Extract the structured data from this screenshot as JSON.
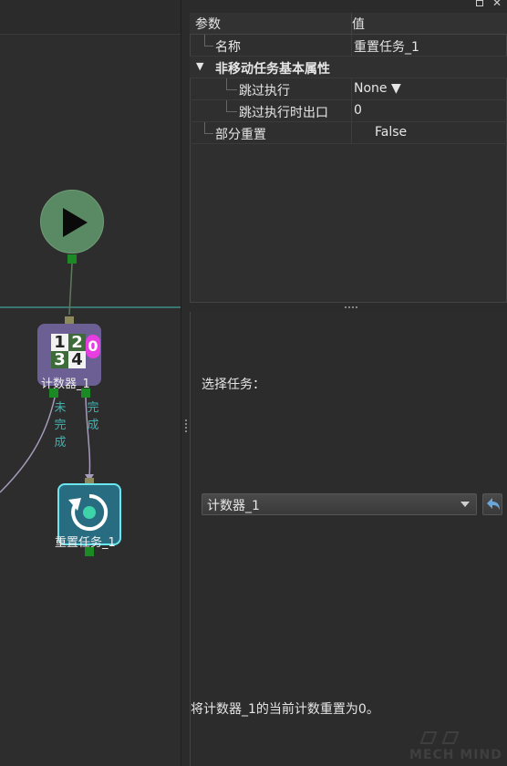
{
  "properties": {
    "header": {
      "param": "参数",
      "value": "值"
    },
    "rows": [
      {
        "key": "名称",
        "value": "重置任务_1"
      },
      {
        "key": "非移动任务基本属性",
        "value": ""
      },
      {
        "key": "跳过执行",
        "value": "None ▼"
      },
      {
        "key": "跳过执行时出口",
        "value": "0"
      },
      {
        "key": "部分重置",
        "value": "False"
      }
    ]
  },
  "config": {
    "select_label": "选择任务：",
    "selected_task": "计数器_1",
    "description": "将计数器_1的当前计数重置为0。"
  },
  "canvas": {
    "counter_node": {
      "label": "计数器_1",
      "badge": "0",
      "digits": [
        "1",
        "2",
        "3",
        "4"
      ]
    },
    "counter_outputs": {
      "incomplete": "未完成",
      "complete": "完成"
    },
    "reset_node": {
      "label": "重置任务_1"
    }
  },
  "watermark": "MECH MIND",
  "colors": {
    "play_node": "#5a8a63",
    "counter_node": "#6c5f93",
    "reset_node": "#276c81",
    "port": "#1b8a25",
    "badge": "#e83de0",
    "output_label": "#43b0b0"
  },
  "icons": [
    "play-icon",
    "counter-icon",
    "reset-icon",
    "dropdown-arrow-icon",
    "back-arrow-icon",
    "float-icon",
    "close-icon"
  ]
}
